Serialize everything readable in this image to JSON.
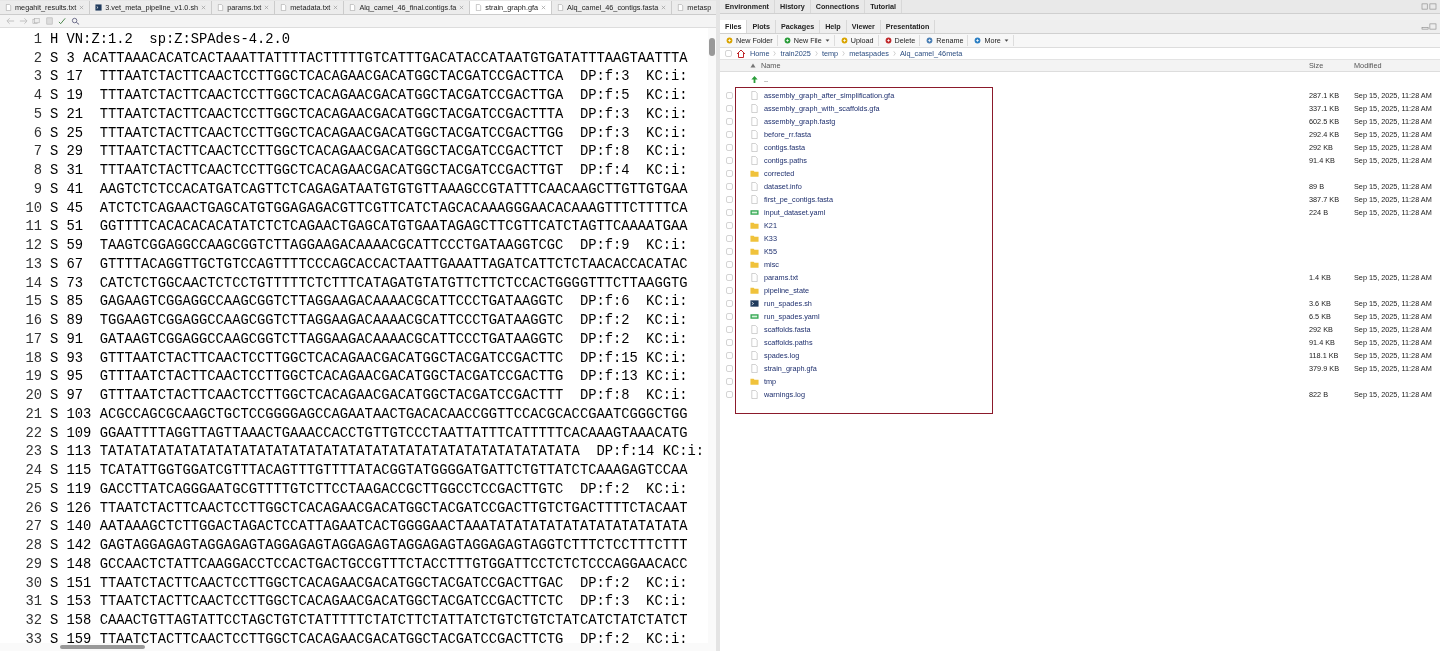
{
  "editor": {
    "tabs": [
      {
        "label": "megahit_results.txt",
        "kind": "text",
        "selected": false
      },
      {
        "label": "3.vet_meta_pipeline_v1.0.sh",
        "kind": "script",
        "selected": false
      },
      {
        "label": "params.txt",
        "kind": "text",
        "selected": false
      },
      {
        "label": "metadata.txt",
        "kind": "text",
        "selected": false
      },
      {
        "label": "Alq_camel_46_final.contigs.fa",
        "kind": "text",
        "selected": false
      },
      {
        "label": "strain_graph.gfa",
        "kind": "text",
        "selected": true
      },
      {
        "label": "Alq_camel_46_contigs.fasta",
        "kind": "text",
        "selected": false
      },
      {
        "label": "metasp",
        "kind": "text",
        "selected": false
      }
    ],
    "lines": [
      {
        "num": "1",
        "text": "H VN:Z:1.2  sp:Z:SPAdes-4.2.0"
      },
      {
        "num": "2",
        "text": "S 3 ACATTAAACACATCACTAAATTATTTTACTTTTTGTCATTTGACATACCATAATGTGATATTTAAGTAATTTA"
      },
      {
        "num": "3",
        "text": "S 17  TTTAATCTACTTCAACTCCTTGGCTCACAGAACGACATGGCTACGATCCGACTTCA  DP:f:3  KC:i:"
      },
      {
        "num": "4",
        "text": "S 19  TTTAATCTACTTCAACTCCTTGGCTCACAGAACGACATGGCTACGATCCGACTTGA  DP:f:5  KC:i:"
      },
      {
        "num": "5",
        "text": "S 21  TTTAATCTACTTCAACTCCTTGGCTCACAGAACGACATGGCTACGATCCGACTTTA  DP:f:3  KC:i:"
      },
      {
        "num": "6",
        "text": "S 25  TTTAATCTACTTCAACTCCTTGGCTCACAGAACGACATGGCTACGATCCGACTTGG  DP:f:3  KC:i:"
      },
      {
        "num": "7",
        "text": "S 29  TTTAATCTACTTCAACTCCTTGGCTCACAGAACGACATGGCTACGATCCGACTTCT  DP:f:8  KC:i:"
      },
      {
        "num": "8",
        "text": "S 31  TTTAATCTACTTCAACTCCTTGGCTCACAGAACGACATGGCTACGATCCGACTTGT  DP:f:4  KC:i:"
      },
      {
        "num": "9",
        "text": "S 41  AAGTCTCTCCACATGATCAGTTCTCAGAGATAATGTGTGTTAAAGCCGTATTTCAACAAGCTTGTTGTGAA"
      },
      {
        "num": "10",
        "text": "S 45  ATCTCTCAGAACTGAGCATGTGGAGAGACGTTCGTTCATCTAGCACAAAGGGAACACAAAGTTTCTTTTCA"
      },
      {
        "num": "11",
        "text": "S 51  GGTTTTCACACACACATATCTCTCAGAACTGAGCATGTGAATAGAGCTTCGTTCATCTAGTTCAAAATGAA"
      },
      {
        "num": "12",
        "text": "S 59  TAAGTCGGAGGCCAAGCGGTCTTAGGAAGACAAAACGCATTCCCTGATAAGGTCGC  DP:f:9  KC:i:"
      },
      {
        "num": "13",
        "text": "S 67  GTTTTACAGGTTGCTGTCCAGTTTTCCCAGCACCACTAATTGAAATTAGATCATTCTCTAACACCACATAC"
      },
      {
        "num": "14",
        "text": "S 73  CATCTCTGGCAACTCTCCTGTTTTTCTCTTTCATAGATGTATGTTCTTCTCCACTGGGGTTTCTTAAGGTG"
      },
      {
        "num": "15",
        "text": "S 85  GAGAAGTCGGAGGCCAAGCGGTCTTAGGAAGACAAAACGCATTCCCTGATAAGGTC  DP:f:6  KC:i:"
      },
      {
        "num": "16",
        "text": "S 89  TGGAAGTCGGAGGCCAAGCGGTCTTAGGAAGACAAAACGCATTCCCTGATAAGGTC  DP:f:2  KC:i:"
      },
      {
        "num": "17",
        "text": "S 91  GATAAGTCGGAGGCCAAGCGGTCTTAGGAAGACAAAACGCATTCCCTGATAAGGTC  DP:f:2  KC:i:"
      },
      {
        "num": "18",
        "text": "S 93  GTTTAATCTACTTCAACTCCTTGGCTCACAGAACGACATGGCTACGATCCGACTTC  DP:f:15 KC:i:"
      },
      {
        "num": "19",
        "text": "S 95  GTTTAATCTACTTCAACTCCTTGGCTCACAGAACGACATGGCTACGATCCGACTTG  DP:f:13 KC:i:"
      },
      {
        "num": "20",
        "text": "S 97  GTTTAATCTACTTCAACTCCTTGGCTCACAGAACGACATGGCTACGATCCGACTTT  DP:f:8  KC:i:"
      },
      {
        "num": "21",
        "text": "S 103 ACGCCAGCGCAAGCTGCTCCGGGGAGCCAGAATAACTGACACAACCGGTTCCACGCACCGAATCGGGCTGG"
      },
      {
        "num": "22",
        "text": "S 109 GGAATTTTAGGTTAGTTAAACTGAAACCACCTGTTGTCCCTAATTATTTCATTTTTCACAAAGTAAACATG"
      },
      {
        "num": "23",
        "text": "S 113 TATATATATATATATATATATATATATATATATATATATATATATATATATATATATA  DP:f:14 KC:i:"
      },
      {
        "num": "24",
        "text": "S 115 TCATATTGGTGGATCGTTTACAGTTTGTTTTATACGGTATGGGGATGATTCTGTTATCTCAAAGAGTCCAA"
      },
      {
        "num": "25",
        "text": "S 119 GACCTTATCAGGGAATGCGTTTTGTCTTCCTAAGACCGCTTGGCCTCCGACTTGTC  DP:f:2  KC:i:"
      },
      {
        "num": "26",
        "text": "S 126 TTAATCTACTTCAACTCCTTGGCTCACAGAACGACATGGCTACGATCCGACTTGTCTGACTTTTCTACAAT"
      },
      {
        "num": "27",
        "text": "S 140 AATAAAGCTCTTGGACTAGACTCCATTAGAATCACTGGGGAACTAAATATATATATATATATATATATATA"
      },
      {
        "num": "28",
        "text": "S 142 GAGTAGGAGAGTAGGAGAGTAGGAGAGTAGGAGAGTAGGAGAGTAGGAGAGTAGGTCTTTCTCCTTTCTTT"
      },
      {
        "num": "29",
        "text": "S 148 GCCAACTCTATTCAAGGACCTCCACTGACTGCCGTTTCTACCTTTGTGGATTCCTCTCTCCCAGGAACACC"
      },
      {
        "num": "30",
        "text": "S 151 TTAATCTACTTCAACTCCTTGGCTCACAGAACGACATGGCTACGATCCGACTTGAC  DP:f:2  KC:i:"
      },
      {
        "num": "31",
        "text": "S 153 TTAATCTACTTCAACTCCTTGGCTCACAGAACGACATGGCTACGATCCGACTTCTC  DP:f:3  KC:i:"
      },
      {
        "num": "32",
        "text": "S 158 CAAACTGTTAGTATTCCTAGCTGTCTATTTTTCTATCTTCTATTATCTGTCTGTCTATCATCTATCTATCT"
      },
      {
        "num": "33",
        "text": "S 159 TTAATCTACTTCAACTCCTTGGCTCACAGAACGACATGGCTACGATCCGACTTCTG  DP:f:2  KC:i:"
      }
    ]
  },
  "top_pane": {
    "tabs": [
      {
        "label": "Environment",
        "selected": false
      },
      {
        "label": "History",
        "selected": false
      },
      {
        "label": "Connections",
        "selected": false
      },
      {
        "label": "Tutorial",
        "selected": false
      }
    ]
  },
  "files_pane": {
    "tabs": [
      {
        "label": "Files",
        "selected": true
      },
      {
        "label": "Plots",
        "selected": false
      },
      {
        "label": "Packages",
        "selected": false
      },
      {
        "label": "Help",
        "selected": false
      },
      {
        "label": "Viewer",
        "selected": false
      },
      {
        "label": "Presentation",
        "selected": false
      }
    ],
    "toolbar": [
      {
        "label": "New Folder",
        "kind": "new-folder",
        "dropdown": false
      },
      {
        "label": "New File",
        "kind": "new-file",
        "dropdown": true
      },
      {
        "label": "Upload",
        "kind": "upload",
        "dropdown": false
      },
      {
        "label": "Delete",
        "kind": "delete",
        "dropdown": false
      },
      {
        "label": "Rename",
        "kind": "rename",
        "dropdown": false
      },
      {
        "label": "More",
        "kind": "more",
        "dropdown": true
      }
    ],
    "select_all": {
      "checked": false
    },
    "breadcrumb": [
      "Home",
      "train2025",
      "temp",
      "metaspades",
      "Alq_camel_46meta"
    ],
    "columns": [
      "Name",
      "Size",
      "Modified"
    ],
    "parent_row": "..",
    "files": [
      {
        "name": "assembly_graph_after_simplification.gfa",
        "kind": "file",
        "size": "287.1 KB",
        "modified": "Sep 15, 2025, 11:28 AM",
        "checked": false
      },
      {
        "name": "assembly_graph_with_scaffolds.gfa",
        "kind": "file",
        "size": "337.1 KB",
        "modified": "Sep 15, 2025, 11:28 AM",
        "checked": false
      },
      {
        "name": "assembly_graph.fastg",
        "kind": "file",
        "size": "602.5 KB",
        "modified": "Sep 15, 2025, 11:28 AM",
        "checked": false
      },
      {
        "name": "before_rr.fasta",
        "kind": "file",
        "size": "292.4 KB",
        "modified": "Sep 15, 2025, 11:28 AM",
        "checked": false
      },
      {
        "name": "contigs.fasta",
        "kind": "file",
        "size": "292 KB",
        "modified": "Sep 15, 2025, 11:28 AM",
        "checked": false
      },
      {
        "name": "contigs.paths",
        "kind": "file",
        "size": "91.4 KB",
        "modified": "Sep 15, 2025, 11:28 AM",
        "checked": false
      },
      {
        "name": "corrected",
        "kind": "folder",
        "checked": false
      },
      {
        "name": "dataset.info",
        "kind": "file",
        "size": "89 B",
        "modified": "Sep 15, 2025, 11:28 AM",
        "checked": false
      },
      {
        "name": "first_pe_contigs.fasta",
        "kind": "file",
        "size": "387.7 KB",
        "modified": "Sep 15, 2025, 11:28 AM",
        "checked": false
      },
      {
        "name": "input_dataset.yaml",
        "kind": "yaml",
        "size": "224 B",
        "modified": "Sep 15, 2025, 11:28 AM",
        "checked": false
      },
      {
        "name": "K21",
        "kind": "folder",
        "checked": false
      },
      {
        "name": "K33",
        "kind": "folder",
        "checked": false
      },
      {
        "name": "K55",
        "kind": "folder",
        "checked": false
      },
      {
        "name": "misc",
        "kind": "folder",
        "checked": false
      },
      {
        "name": "params.txt",
        "kind": "file",
        "size": "1.4 KB",
        "modified": "Sep 15, 2025, 11:28 AM",
        "checked": false
      },
      {
        "name": "pipeline_state",
        "kind": "folder",
        "checked": false
      },
      {
        "name": "run_spades.sh",
        "kind": "script",
        "size": "3.6 KB",
        "modified": "Sep 15, 2025, 11:28 AM",
        "checked": false
      },
      {
        "name": "run_spades.yaml",
        "kind": "yaml",
        "size": "6.5 KB",
        "modified": "Sep 15, 2025, 11:28 AM",
        "checked": false
      },
      {
        "name": "scaffolds.fasta",
        "kind": "file",
        "size": "292 KB",
        "modified": "Sep 15, 2025, 11:28 AM",
        "checked": false
      },
      {
        "name": "scaffolds.paths",
        "kind": "file",
        "size": "91.4 KB",
        "modified": "Sep 15, 2025, 11:28 AM",
        "checked": false
      },
      {
        "name": "spades.log",
        "kind": "file",
        "size": "118.1 KB",
        "modified": "Sep 15, 2025, 11:28 AM",
        "checked": false
      },
      {
        "name": "strain_graph.gfa",
        "kind": "file",
        "size": "379.9 KB",
        "modified": "Sep 15, 2025, 11:28 AM",
        "checked": false
      },
      {
        "name": "tmp",
        "kind": "folder",
        "checked": false
      },
      {
        "name": "warnings.log",
        "kind": "file",
        "size": "822 B",
        "modified": "Sep 15, 2025, 11:28 AM",
        "checked": false
      }
    ]
  }
}
